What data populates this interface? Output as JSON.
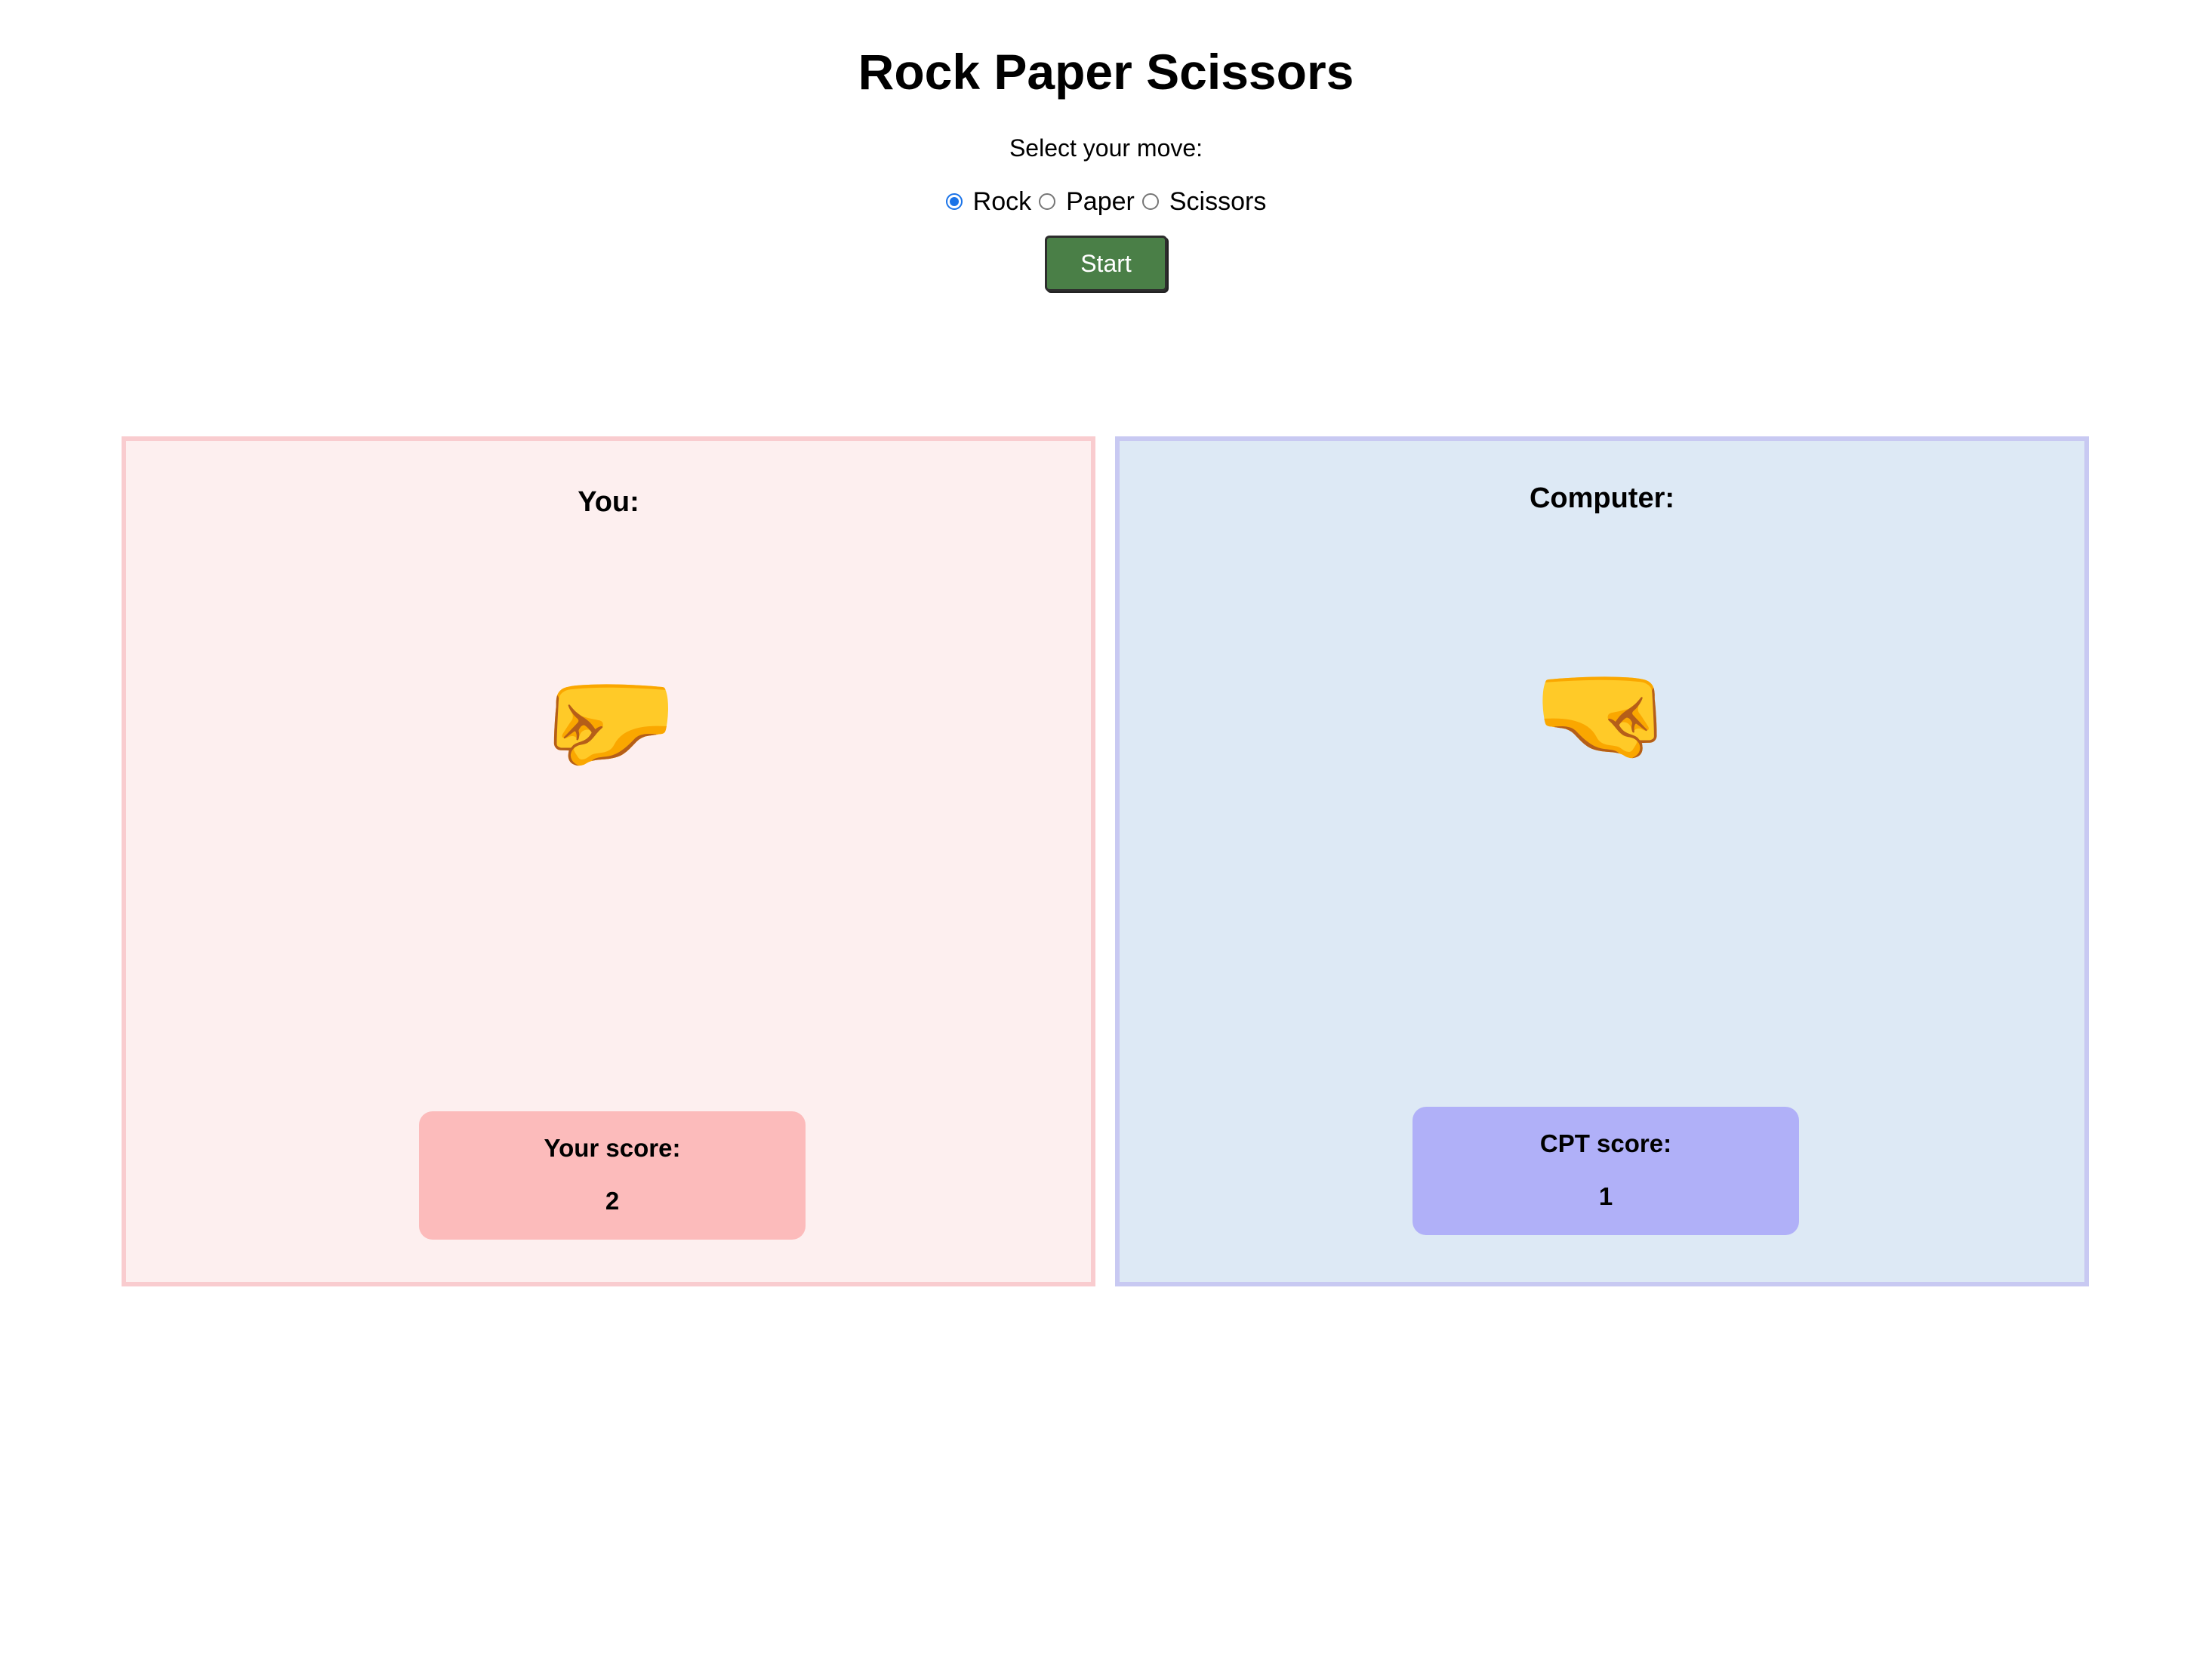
{
  "header": {
    "title": "Rock Paper Scissors",
    "prompt": "Select your move:"
  },
  "moves": {
    "options": [
      {
        "label": "Rock",
        "checked": true
      },
      {
        "label": "Paper",
        "checked": false
      },
      {
        "label": "Scissors",
        "checked": false
      }
    ],
    "selected": "Rock"
  },
  "controls": {
    "start_label": "Start"
  },
  "player": {
    "title": "You:",
    "hand_icon": "left-facing-fist-icon",
    "hand_glyph": "🤛",
    "score_label": "Your score:",
    "score_value": "2",
    "panel_color": "#fdefef",
    "border_color": "#f9cccf",
    "score_color": "#fcbbbb"
  },
  "computer": {
    "title": "Computer:",
    "hand_icon": "right-facing-fist-icon",
    "hand_glyph": "🤛",
    "score_label": "CPT score:",
    "score_value": "1",
    "panel_color": "#dde9f5",
    "border_color": "#c8c9f2",
    "score_color": "#b0b0f8"
  },
  "colors": {
    "start_button": "#4a7f47",
    "radio_accent": "#1a73e8"
  }
}
